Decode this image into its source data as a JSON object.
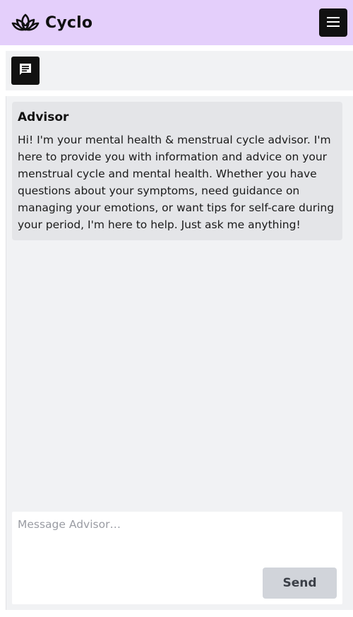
{
  "header": {
    "app_name": "Cyclo",
    "logo_icon": "lotus-icon",
    "menu_icon": "hamburger-menu-icon"
  },
  "toolbar": {
    "chat_icon": "chat-bubble-icon"
  },
  "chat": {
    "messages": [
      {
        "sender": "Advisor",
        "text": "Hi! I'm your mental health & menstrual cycle advisor. I'm here to provide you with information and advice on your menstrual cycle and mental health. Whether you have questions about your symptoms, need guidance on managing your emotions, or want tips for self-care during your period, I'm here to help. Just ask me anything!"
      }
    ]
  },
  "composer": {
    "placeholder": "Message Advisor…",
    "value": "",
    "send_label": "Send"
  },
  "colors": {
    "header_bg": "#e4cffb",
    "panel_bg": "#f1f2f4",
    "message_bg": "#e4e5e8",
    "button_dark": "#111111",
    "send_button_bg": "#d1d4da"
  }
}
